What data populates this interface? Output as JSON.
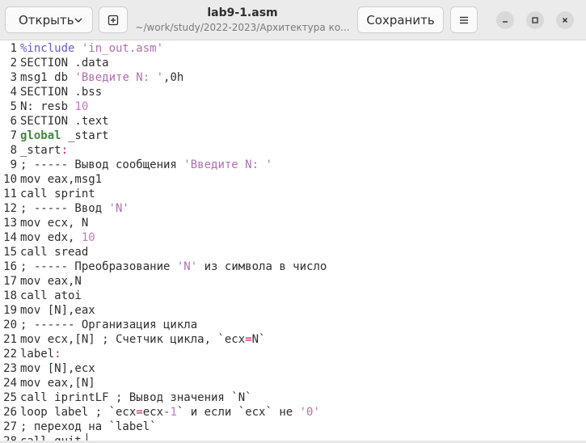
{
  "header": {
    "open_label": "Открыть",
    "title": "lab9-1.asm",
    "subtitle": "~/work/study/2022-2023/Архитектура ко...",
    "save_label": "Сохранить"
  },
  "icons": {
    "open_dropdown": "chevron-down-icon",
    "new_tab": "new-document-icon",
    "menu": "hamburger-menu-icon",
    "minimize": "minimize-icon",
    "maximize": "maximize-icon",
    "close": "close-icon"
  },
  "editor": {
    "lines": [
      {
        "n": "1",
        "segs": [
          [
            "kw-inc",
            "%include "
          ],
          [
            "str",
            "'in_out.asm'"
          ]
        ]
      },
      {
        "n": "2",
        "segs": [
          [
            "",
            "SECTION .data"
          ]
        ]
      },
      {
        "n": "3",
        "segs": [
          [
            "",
            "msg1 db "
          ],
          [
            "str",
            "'Введите N: '"
          ],
          [
            "",
            ",0h"
          ]
        ]
      },
      {
        "n": "4",
        "segs": [
          [
            "",
            "SECTION .bss"
          ]
        ]
      },
      {
        "n": "5",
        "segs": [
          [
            "",
            "N: resb "
          ],
          [
            "num",
            "10"
          ]
        ]
      },
      {
        "n": "6",
        "segs": [
          [
            "",
            "SECTION .text"
          ]
        ]
      },
      {
        "n": "7",
        "segs": [
          [
            "kw",
            "global"
          ],
          [
            "",
            " _start"
          ]
        ]
      },
      {
        "n": "8",
        "segs": [
          [
            "",
            "_start"
          ],
          [
            "lbl",
            ":"
          ]
        ]
      },
      {
        "n": "9",
        "segs": [
          [
            "",
            "; ----- Вывод сообщения "
          ],
          [
            "str",
            "'Введите N: '"
          ]
        ]
      },
      {
        "n": "10",
        "segs": [
          [
            "",
            "mov eax,msg1"
          ]
        ]
      },
      {
        "n": "11",
        "segs": [
          [
            "",
            "call sprint"
          ]
        ]
      },
      {
        "n": "12",
        "segs": [
          [
            "",
            "; ----- Ввод "
          ],
          [
            "str",
            "'N'"
          ]
        ]
      },
      {
        "n": "13",
        "segs": [
          [
            "",
            "mov ecx, N"
          ]
        ]
      },
      {
        "n": "14",
        "segs": [
          [
            "",
            "mov edx, "
          ],
          [
            "num",
            "10"
          ]
        ]
      },
      {
        "n": "15",
        "segs": [
          [
            "",
            "call sread"
          ]
        ]
      },
      {
        "n": "16",
        "segs": [
          [
            "",
            "; ----- Преобразование "
          ],
          [
            "str",
            "'N'"
          ],
          [
            "",
            " из символа в число"
          ]
        ]
      },
      {
        "n": "17",
        "segs": [
          [
            "",
            "mov eax,N"
          ]
        ]
      },
      {
        "n": "18",
        "segs": [
          [
            "",
            "call atoi"
          ]
        ]
      },
      {
        "n": "19",
        "segs": [
          [
            "",
            "mov [N],eax"
          ]
        ]
      },
      {
        "n": "20",
        "segs": [
          [
            "",
            "; ------ Организация цикла"
          ]
        ]
      },
      {
        "n": "21",
        "segs": [
          [
            "",
            "mov ecx,[N] ; Счетчик цикла, `ecx"
          ],
          [
            "op",
            "="
          ],
          [
            "",
            "N`"
          ]
        ]
      },
      {
        "n": "22",
        "segs": [
          [
            "",
            "label"
          ],
          [
            "lbl",
            ":"
          ]
        ]
      },
      {
        "n": "23",
        "segs": [
          [
            "",
            "mov [N],ecx"
          ]
        ]
      },
      {
        "n": "24",
        "segs": [
          [
            "",
            "mov eax,[N]"
          ]
        ]
      },
      {
        "n": "25",
        "segs": [
          [
            "",
            "call iprintLF ; Вывод значения `N`"
          ]
        ]
      },
      {
        "n": "26",
        "segs": [
          [
            "",
            "loop label ; `ecx"
          ],
          [
            "op",
            "="
          ],
          [
            "",
            "ecx"
          ],
          [
            "op",
            "-"
          ],
          [
            "num",
            "1"
          ],
          [
            "",
            "` и если `ecx` не "
          ],
          [
            "str",
            "'0'"
          ]
        ]
      },
      {
        "n": "27",
        "segs": [
          [
            "",
            "; переход на `label`"
          ]
        ]
      },
      {
        "n": "28",
        "segs": [
          [
            "",
            "call quit"
          ]
        ]
      }
    ]
  }
}
